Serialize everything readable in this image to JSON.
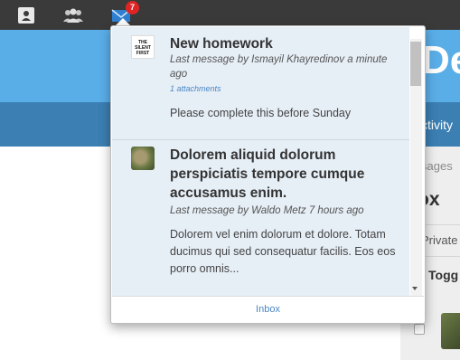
{
  "navbar": {
    "user_icon": "user-icon",
    "group_icon": "group-icon",
    "mail_icon": "envelope-icon",
    "unread_count": "7"
  },
  "background": {
    "title_fragment": "De",
    "activity_tab": "ctivity",
    "messages_crumb": "sages",
    "inbox_heading": "ox",
    "private_tab": "Private",
    "toggle_label": "Togg"
  },
  "messages": [
    {
      "avatar_text": "THE SILENT FIRST",
      "title": "New homework",
      "meta": "Last message by Ismayil Khayredinov a minute ago",
      "attachments": "1 attachments",
      "body": "Please complete this before Sunday"
    },
    {
      "title": "Dolorem aliquid dolorum perspiciatis tempore cumque accusamus enim.",
      "meta": "Last message by Waldo Metz 7 hours ago",
      "body": "Dolorem vel enim dolorum et dolore. Totam ducimus qui sed consequatur facilis. Eos eos porro omnis..."
    }
  ],
  "footer": {
    "inbox_link": "Inbox"
  },
  "colors": {
    "navbar": "#3a3a3a",
    "header_blue": "#5aaee8",
    "nav_bar_blue": "#3b7fb3",
    "badge_red": "#e02424",
    "link_blue": "#4a86c5",
    "dropdown_item_bg": "#e6eef6"
  }
}
